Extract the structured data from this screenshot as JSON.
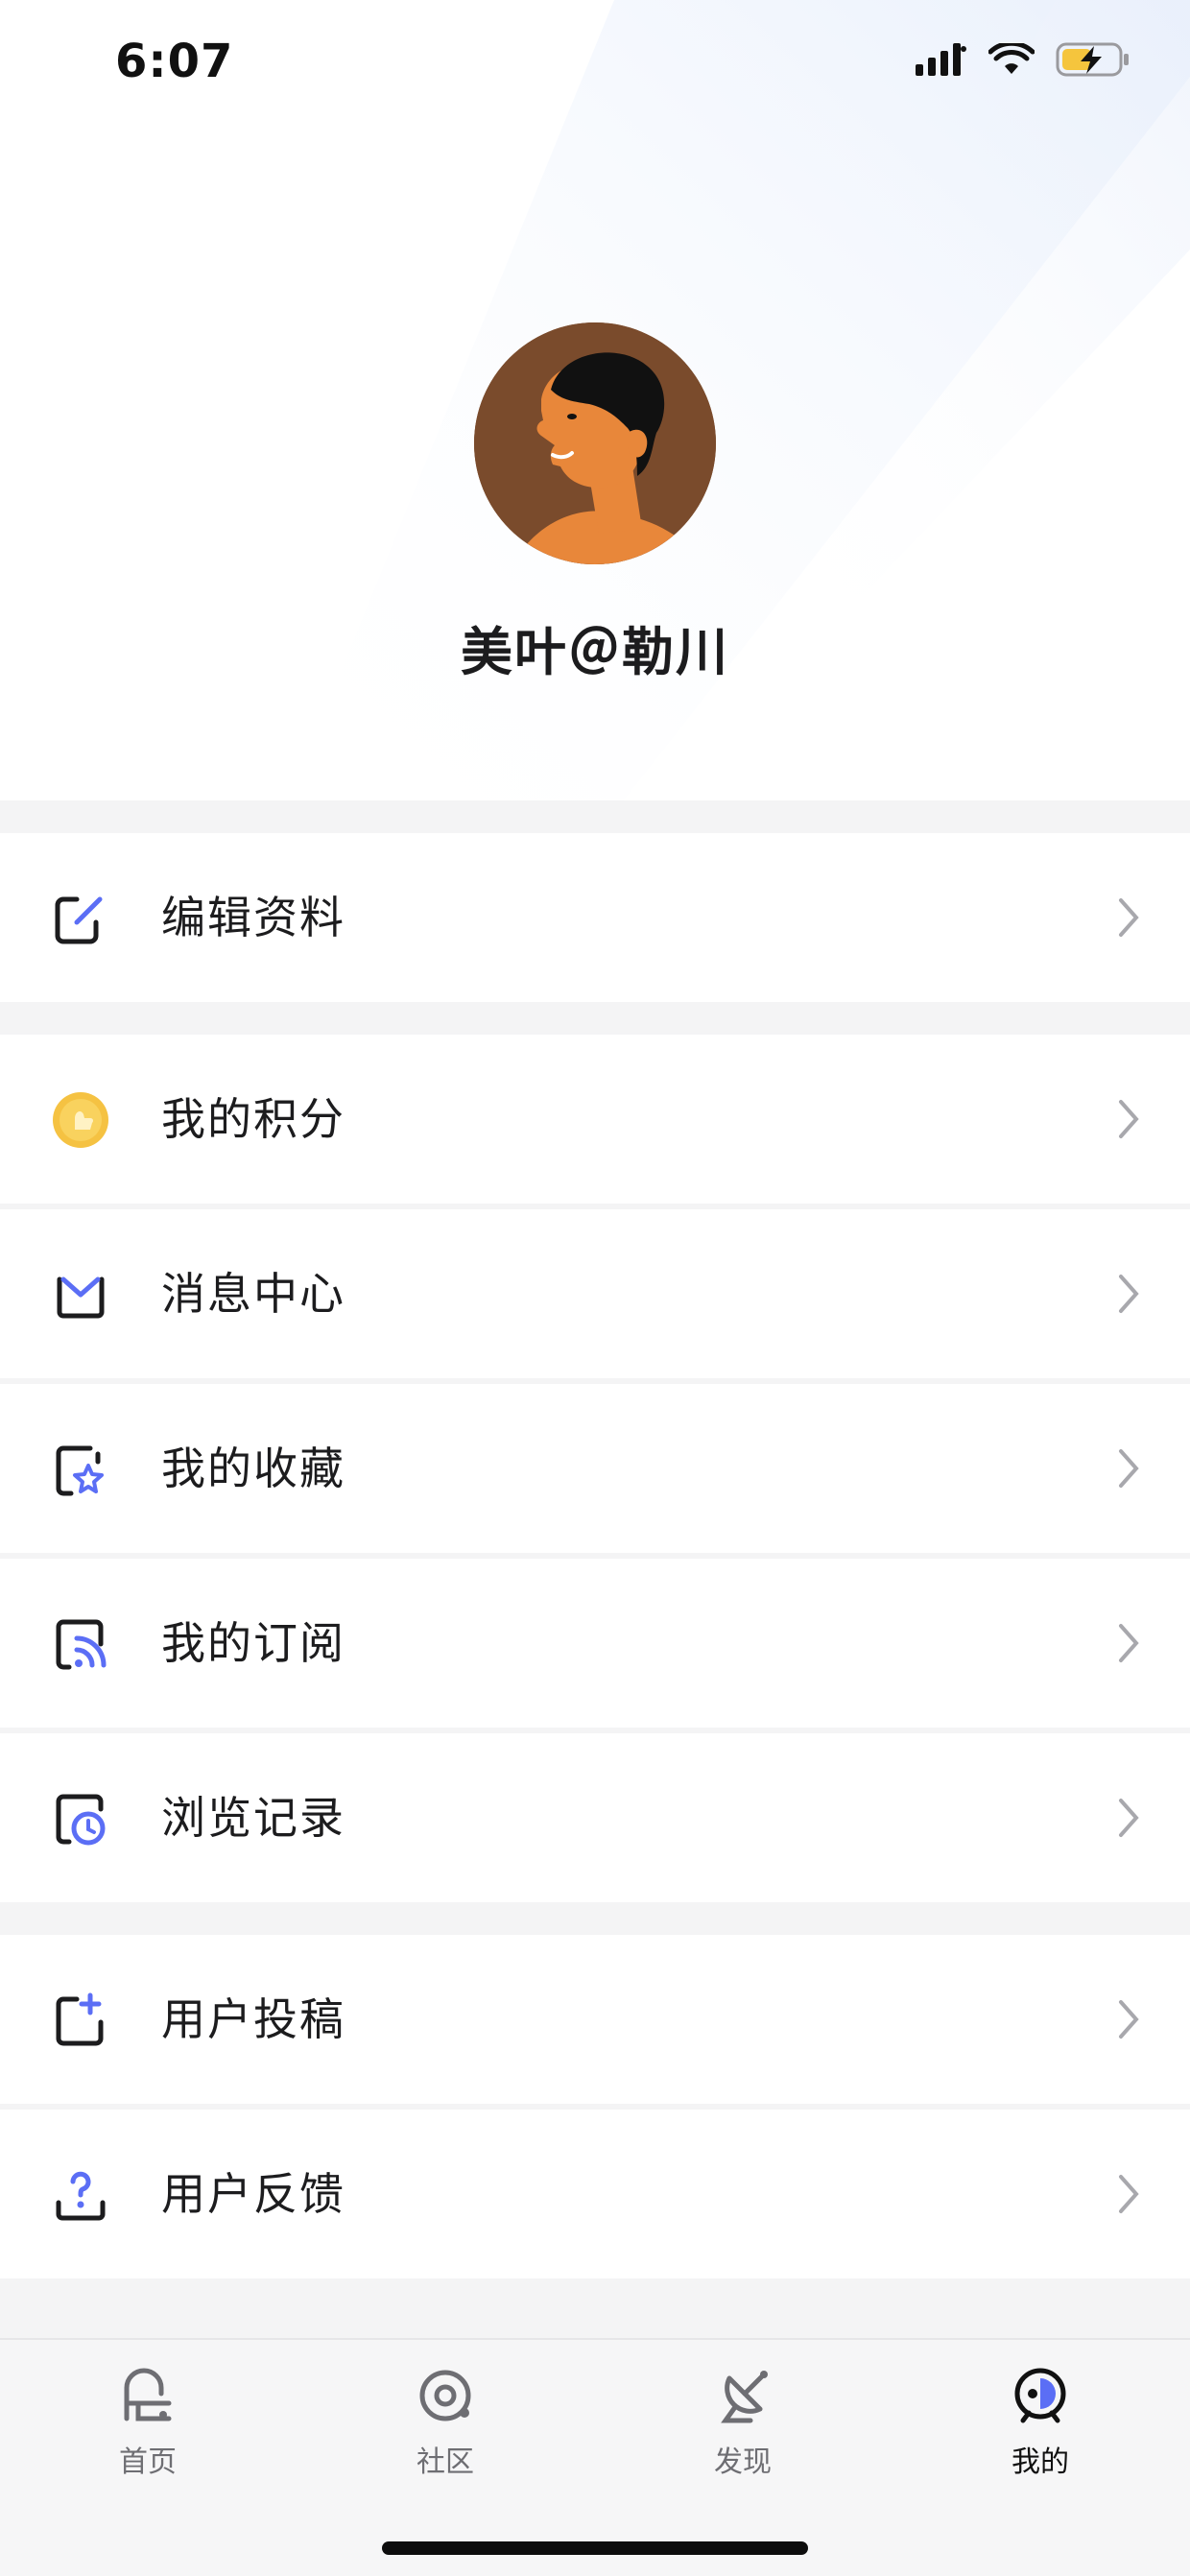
{
  "status_bar": {
    "time": "6:07",
    "icons": [
      "signal-icon",
      "wifi-icon",
      "battery-charging-icon"
    ]
  },
  "profile": {
    "username": "美叶＠勒川"
  },
  "menu": {
    "edit_profile": "编辑资料",
    "my_points": "我的积分",
    "message_center": "消息中心",
    "my_favorites": "我的收藏",
    "my_subscriptions": "我的订阅",
    "browse_history": "浏览记录",
    "user_submission": "用户投稿",
    "user_feedback": "用户反馈"
  },
  "tabs": {
    "home": "首页",
    "community": "社区",
    "discover": "发现",
    "mine": "我的",
    "active": "我的"
  },
  "colors": {
    "accent": "#5b6ef5",
    "coin": "#f5c242",
    "avatar_bg": "#7a4b2c",
    "skin": "#e8873a"
  }
}
